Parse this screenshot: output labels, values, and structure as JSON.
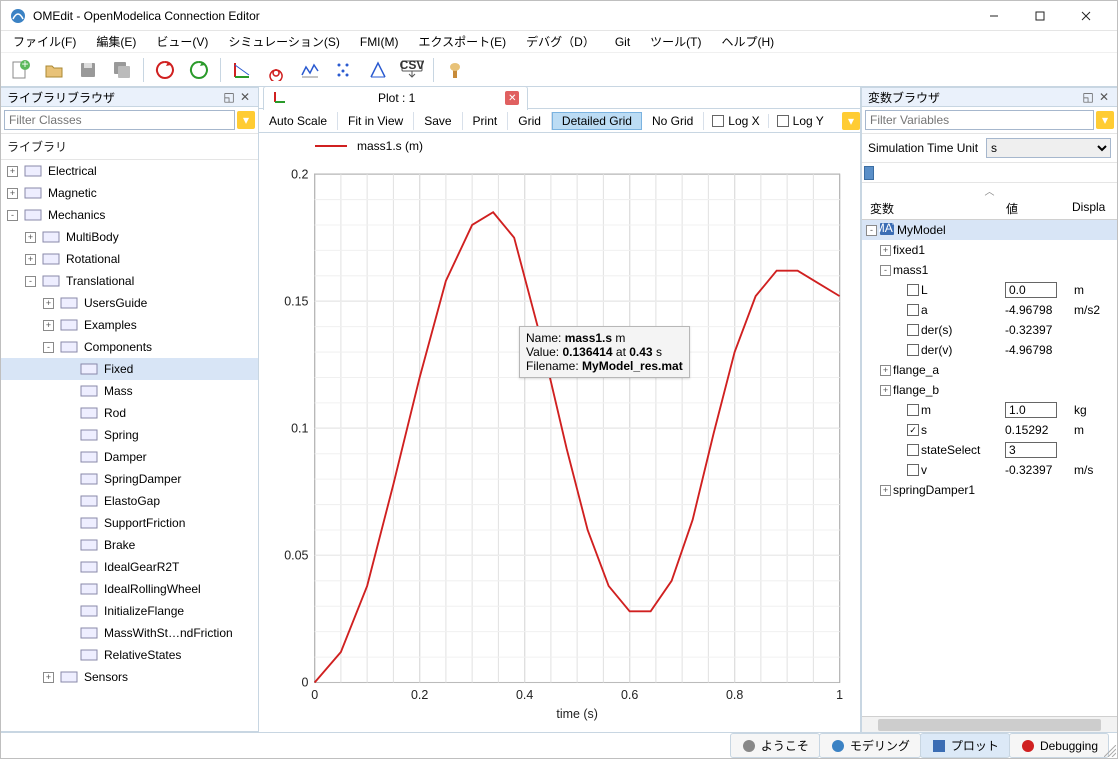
{
  "window": {
    "title": "OMEdit - OpenModelica Connection Editor"
  },
  "menu": [
    "ファイル(F)",
    "編集(E)",
    "ビュー(V)",
    "シミュレーション(S)",
    "FMI(M)",
    "エクスポート(E)",
    "デバグ（D）",
    "Git",
    "ツール(T)",
    "ヘルプ(H)"
  ],
  "left_panel": {
    "title": "ライブラリブラウザ",
    "filter_placeholder": "Filter Classes",
    "tree_header": "ライブラリ",
    "items": [
      {
        "depth": 0,
        "tw": "+",
        "label": "Electrical"
      },
      {
        "depth": 0,
        "tw": "+",
        "label": "Magnetic"
      },
      {
        "depth": 0,
        "tw": "-",
        "label": "Mechanics"
      },
      {
        "depth": 1,
        "tw": "+",
        "label": "MultiBody"
      },
      {
        "depth": 1,
        "tw": "+",
        "label": "Rotational"
      },
      {
        "depth": 1,
        "tw": "-",
        "label": "Translational"
      },
      {
        "depth": 2,
        "tw": "+",
        "label": "UsersGuide"
      },
      {
        "depth": 2,
        "tw": "+",
        "label": "Examples"
      },
      {
        "depth": 2,
        "tw": "-",
        "label": "Components"
      },
      {
        "depth": 3,
        "tw": "",
        "label": "Fixed",
        "sel": true
      },
      {
        "depth": 3,
        "tw": "",
        "label": "Mass"
      },
      {
        "depth": 3,
        "tw": "",
        "label": "Rod"
      },
      {
        "depth": 3,
        "tw": "",
        "label": "Spring"
      },
      {
        "depth": 3,
        "tw": "",
        "label": "Damper"
      },
      {
        "depth": 3,
        "tw": "",
        "label": "SpringDamper"
      },
      {
        "depth": 3,
        "tw": "",
        "label": "ElastoGap"
      },
      {
        "depth": 3,
        "tw": "",
        "label": "SupportFriction"
      },
      {
        "depth": 3,
        "tw": "",
        "label": "Brake"
      },
      {
        "depth": 3,
        "tw": "",
        "label": "IdealGearR2T"
      },
      {
        "depth": 3,
        "tw": "",
        "label": "IdealRollingWheel"
      },
      {
        "depth": 3,
        "tw": "",
        "label": "InitializeFlange"
      },
      {
        "depth": 3,
        "tw": "",
        "label": "MassWithSt…ndFriction"
      },
      {
        "depth": 3,
        "tw": "",
        "label": "RelativeStates"
      },
      {
        "depth": 2,
        "tw": "+",
        "label": "Sensors"
      }
    ]
  },
  "plot": {
    "tab_label": "Plot : 1",
    "options": [
      "Auto Scale",
      "Fit in View",
      "Save",
      "Print",
      "Grid",
      "Detailed Grid",
      "No Grid",
      "Log X",
      "Log Y"
    ],
    "legend": "mass1.s (m)",
    "xlabel": "time (s)",
    "x_ticks": [
      "0",
      "0.2",
      "0.4",
      "0.6",
      "0.8",
      "1"
    ],
    "y_ticks": [
      "0",
      "0.05",
      "0.1",
      "0.15",
      "0.2"
    ],
    "tooltip": {
      "name_label": "Name:",
      "name": "mass1.s",
      "name_unit": "m",
      "value_label": "Value:",
      "value": "0.136414",
      "at": "at",
      "time": "0.43",
      "time_unit": "s",
      "file_label": "Filename:",
      "file": "MyModel_res.mat"
    }
  },
  "chart_data": {
    "type": "line",
    "title": "",
    "xlabel": "time (s)",
    "ylabel": "",
    "xlim": [
      0,
      1
    ],
    "ylim": [
      0,
      0.2
    ],
    "series": [
      {
        "name": "mass1.s (m)",
        "color": "#d02020",
        "x": [
          0,
          0.05,
          0.1,
          0.15,
          0.2,
          0.25,
          0.3,
          0.34,
          0.38,
          0.43,
          0.48,
          0.52,
          0.56,
          0.6,
          0.64,
          0.68,
          0.72,
          0.76,
          0.8,
          0.84,
          0.88,
          0.92,
          0.96,
          1.0
        ],
        "y": [
          0,
          0.012,
          0.038,
          0.078,
          0.12,
          0.158,
          0.18,
          0.185,
          0.175,
          0.136,
          0.092,
          0.06,
          0.038,
          0.028,
          0.028,
          0.04,
          0.064,
          0.098,
          0.13,
          0.152,
          0.162,
          0.162,
          0.157,
          0.152
        ]
      }
    ],
    "marker": {
      "x": 0.43,
      "y": 0.136414
    }
  },
  "right_panel": {
    "title": "変数ブラウザ",
    "filter_placeholder": "Filter Variables",
    "time_unit_label": "Simulation Time Unit",
    "time_unit_value": "s",
    "headers": [
      "変数",
      "値",
      "Displa"
    ],
    "rows": [
      {
        "d": 0,
        "tw": "-",
        "icon": "mat",
        "label": "MyModel",
        "sel": true
      },
      {
        "d": 1,
        "tw": "+",
        "label": "fixed1"
      },
      {
        "d": 1,
        "tw": "-",
        "label": "mass1"
      },
      {
        "d": 2,
        "ck": false,
        "label": "L",
        "val": "0.0",
        "unit": "m",
        "edit": true
      },
      {
        "d": 2,
        "ck": false,
        "label": "a",
        "val": "-4.96798",
        "unit": "m/s2"
      },
      {
        "d": 2,
        "ck": false,
        "label": "der(s)",
        "val": "-0.32397"
      },
      {
        "d": 2,
        "ck": false,
        "label": "der(v)",
        "val": "-4.96798"
      },
      {
        "d": 1,
        "tw": "+",
        "label": "flange_a"
      },
      {
        "d": 1,
        "tw": "+",
        "label": "flange_b"
      },
      {
        "d": 2,
        "ck": false,
        "label": "m",
        "val": "1.0",
        "unit": "kg",
        "edit": true
      },
      {
        "d": 2,
        "ck": true,
        "label": "s",
        "val": "0.15292",
        "unit": "m"
      },
      {
        "d": 2,
        "ck": false,
        "label": "stateSelect",
        "val": "3",
        "edit": true
      },
      {
        "d": 2,
        "ck": false,
        "label": "v",
        "val": "-0.32397",
        "unit": "m/s"
      },
      {
        "d": 1,
        "tw": "+",
        "label": "springDamper1"
      }
    ]
  },
  "status_tabs": [
    {
      "label": "ようこそ",
      "icon": "welcome"
    },
    {
      "label": "モデリング",
      "icon": "modeling"
    },
    {
      "label": "プロット",
      "icon": "plot",
      "sel": true
    },
    {
      "label": "Debugging",
      "icon": "debug"
    }
  ]
}
